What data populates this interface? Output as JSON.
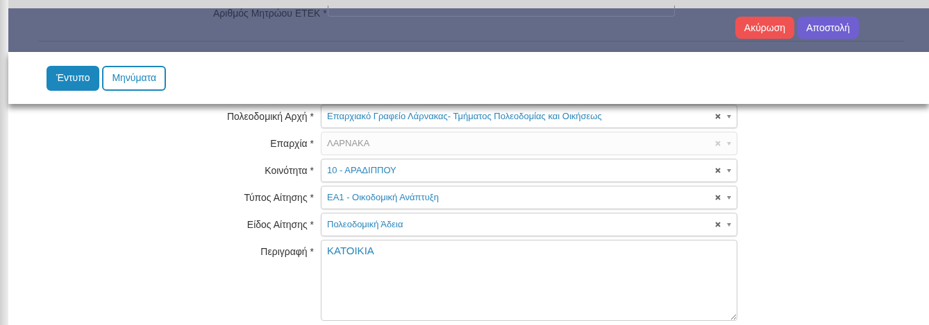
{
  "header": {
    "etek_label": "Αριθμός Μητρώου ΕΤΕΚ *",
    "buttons": [
      {
        "label": "Ακύρωση",
        "kind": "cancel"
      },
      {
        "label": "Αποστολή",
        "kind": "submit"
      }
    ]
  },
  "tabs": [
    {
      "label": "Έντυπο",
      "selected": true
    },
    {
      "label": "Μηνύματα",
      "selected": false
    }
  ],
  "fields": [
    {
      "label": "Πολεοδομική Αρχή *",
      "kind": "select",
      "value": "Επαρχιακό Γραφείο Λάρνακας- Τμήματος Πολεοδομίας και Οικήσεως",
      "disabled": false
    },
    {
      "label": "Επαρχία *",
      "kind": "select",
      "value": "ΛΑΡΝΑΚΑ",
      "disabled": true
    },
    {
      "label": "Κοινότητα *",
      "kind": "select",
      "value": "10 - ΑΡΑΔΙΠΠΟΥ",
      "disabled": false
    },
    {
      "label": "Τύπος Αίτησης *",
      "kind": "select",
      "value": "ΕΑ1 - Οικοδομική Ανάπτυξη",
      "disabled": false
    },
    {
      "label": "Είδος Αίτησης *",
      "kind": "select",
      "value": "Πολεοδομική Άδεια",
      "disabled": false
    },
    {
      "label": "Περιγραφή *",
      "kind": "textarea",
      "value": "ΚΑΤΟΙΚΙΑ"
    }
  ]
}
